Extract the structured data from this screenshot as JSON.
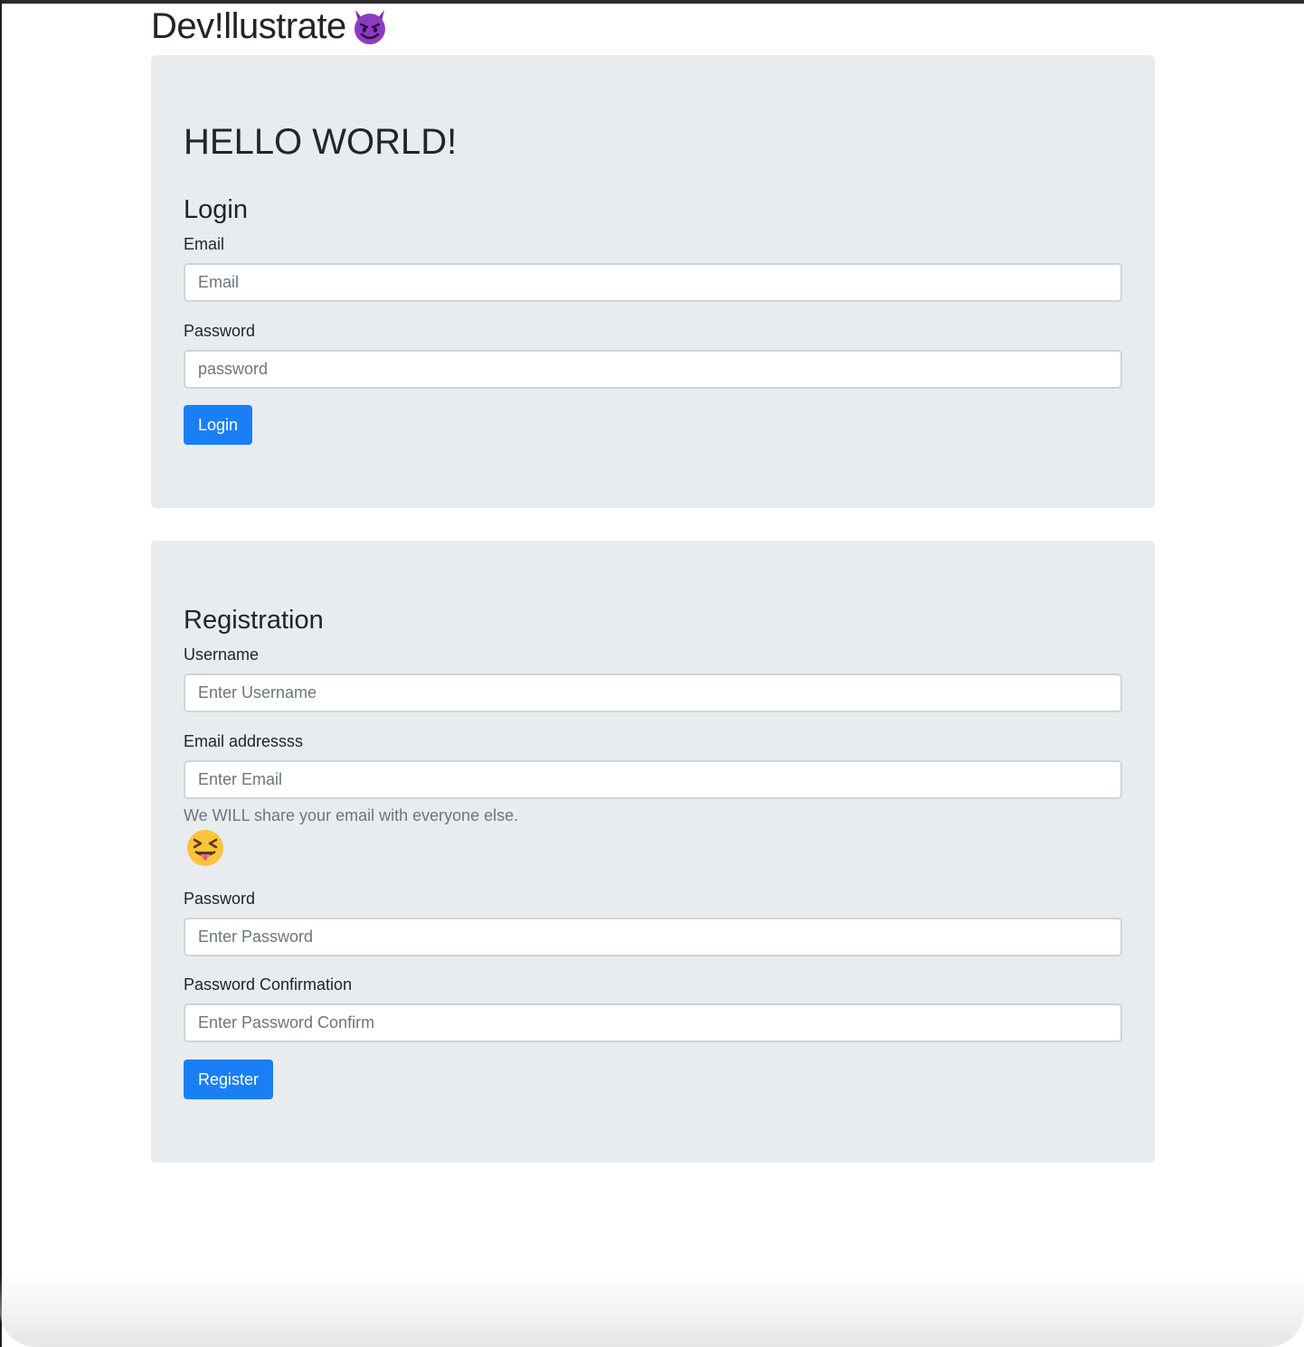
{
  "brand": {
    "title": "Dev!llustrate",
    "emoji_icon": "smiling-face-with-horns-icon"
  },
  "login": {
    "heading": "HELLO WORLD!",
    "title": "Login",
    "email_label": "Email",
    "email_placeholder": "Email",
    "password_label": "Password",
    "password_placeholder": "password",
    "submit_label": "Login"
  },
  "registration": {
    "title": "Registration",
    "username_label": "Username",
    "username_placeholder": "Enter Username",
    "email_label": "Email addressss",
    "email_placeholder": "Enter Email",
    "email_help": "We WILL share your email with everyone else.",
    "help_emoji_icon": "squinting-face-with-tongue-icon",
    "password_label": "Password",
    "password_placeholder": "Enter Password",
    "confirm_label": "Password Confirmation",
    "confirm_placeholder": "Enter Password Confirm",
    "submit_label": "Register"
  },
  "colors": {
    "panel_background": "#e9ecef",
    "primary_button": "#1a7ff6",
    "muted_text": "#6c757d"
  }
}
